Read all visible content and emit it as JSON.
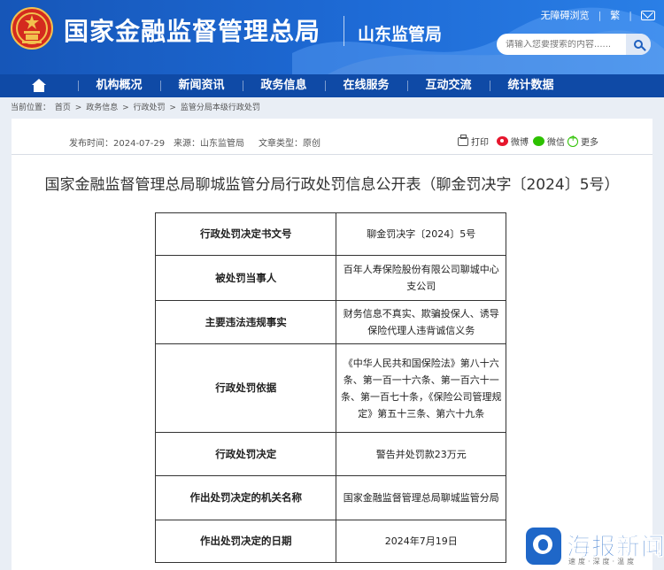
{
  "header": {
    "site_title": "国家金融监督管理总局",
    "branch_name": "山东监管局",
    "top_links": [
      "无障碍浏览",
      "繁"
    ],
    "search_placeholder": "请输入您要搜索的内容......"
  },
  "nav": {
    "home_icon": "home-icon",
    "items": [
      {
        "label": "机构概况"
      },
      {
        "label": "新闻资讯"
      },
      {
        "label": "政务信息"
      },
      {
        "label": "在线服务"
      },
      {
        "label": "互动交流"
      },
      {
        "label": "统计数据"
      }
    ]
  },
  "breadcrumb": {
    "prefix": "当前位置：",
    "items": [
      "首页",
      "政务信息",
      "行政处罚",
      "监管分局本级行政处罚"
    ],
    "separator": ">"
  },
  "article": {
    "meta": {
      "date_label": "发布时间：",
      "date": "2024-07-29",
      "source_label": "来源：",
      "source": "山东监管局",
      "type_label": "文章类型：",
      "type": "原创"
    },
    "share": {
      "print": "打印",
      "weibo": "微博",
      "wechat": "微信",
      "more": "更多"
    },
    "title": "国家金融监督管理总局聊城监管分局行政处罚信息公开表（聊金罚决字〔2024〕5号）",
    "table": {
      "rows": [
        {
          "label": "行政处罚决定书文号",
          "value": "聊金罚决字〔2024〕5号"
        },
        {
          "label": "被处罚当事人",
          "value": "百年人寿保险股份有限公司聊城中心支公司"
        },
        {
          "label": "主要违法违规事实",
          "value": "财务信息不真实、欺骗投保人、诱导保险代理人违背诚信义务"
        },
        {
          "label": "行政处罚依据",
          "value": "《中华人民共和国保险法》第八十六条、第一百一十六条、第一百六十一条、第一百七十条，《保险公司管理规定》第五十三条、第六十九条"
        },
        {
          "label": "行政处罚决定",
          "value": "警告并处罚款23万元"
        },
        {
          "label": "作出处罚决定的机关名称",
          "value": "国家金融监督管理总局聊城监管分局"
        },
        {
          "label": "作出处罚决定的日期",
          "value": "2024年7月19日"
        }
      ]
    }
  },
  "watermark": {
    "name": "海报新闻",
    "slogan": "速度·深度·温度"
  },
  "colors": {
    "header_blue": "#1e6bd6",
    "nav_blue": "#0f4aa6",
    "page_bg": "#e9eef5"
  }
}
